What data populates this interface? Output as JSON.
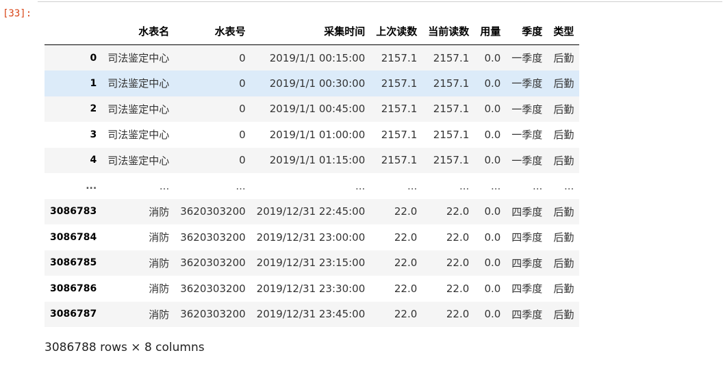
{
  "cell": {
    "prompt": "[33]:"
  },
  "table": {
    "columns": [
      "水表名",
      "水表号",
      "采集时间",
      "上次读数",
      "当前读数",
      "用量",
      "季度",
      "类型"
    ],
    "rows": [
      {
        "index": "0",
        "cells": [
          "司法鉴定中心",
          "0",
          "2019/1/1 00:15:00",
          "2157.1",
          "2157.1",
          "0.0",
          "一季度",
          "后勤"
        ]
      },
      {
        "index": "1",
        "cells": [
          "司法鉴定中心",
          "0",
          "2019/1/1 00:30:00",
          "2157.1",
          "2157.1",
          "0.0",
          "一季度",
          "后勤"
        ]
      },
      {
        "index": "2",
        "cells": [
          "司法鉴定中心",
          "0",
          "2019/1/1 00:45:00",
          "2157.1",
          "2157.1",
          "0.0",
          "一季度",
          "后勤"
        ]
      },
      {
        "index": "3",
        "cells": [
          "司法鉴定中心",
          "0",
          "2019/1/1 01:00:00",
          "2157.1",
          "2157.1",
          "0.0",
          "一季度",
          "后勤"
        ]
      },
      {
        "index": "4",
        "cells": [
          "司法鉴定中心",
          "0",
          "2019/1/1 01:15:00",
          "2157.1",
          "2157.1",
          "0.0",
          "一季度",
          "后勤"
        ]
      },
      {
        "index": "...",
        "cells": [
          "...",
          "...",
          "...",
          "...",
          "...",
          "...",
          "...",
          "..."
        ]
      },
      {
        "index": "3086783",
        "cells": [
          "消防",
          "3620303200",
          "2019/12/31 22:45:00",
          "22.0",
          "22.0",
          "0.0",
          "四季度",
          "后勤"
        ]
      },
      {
        "index": "3086784",
        "cells": [
          "消防",
          "3620303200",
          "2019/12/31 23:00:00",
          "22.0",
          "22.0",
          "0.0",
          "四季度",
          "后勤"
        ]
      },
      {
        "index": "3086785",
        "cells": [
          "消防",
          "3620303200",
          "2019/12/31 23:15:00",
          "22.0",
          "22.0",
          "0.0",
          "四季度",
          "后勤"
        ]
      },
      {
        "index": "3086786",
        "cells": [
          "消防",
          "3620303200",
          "2019/12/31 23:30:00",
          "22.0",
          "22.0",
          "0.0",
          "四季度",
          "后勤"
        ]
      },
      {
        "index": "3086787",
        "cells": [
          "消防",
          "3620303200",
          "2019/12/31 23:45:00",
          "22.0",
          "22.0",
          "0.0",
          "四季度",
          "后勤"
        ]
      }
    ]
  },
  "summary": "3086788 rows × 8 columns"
}
